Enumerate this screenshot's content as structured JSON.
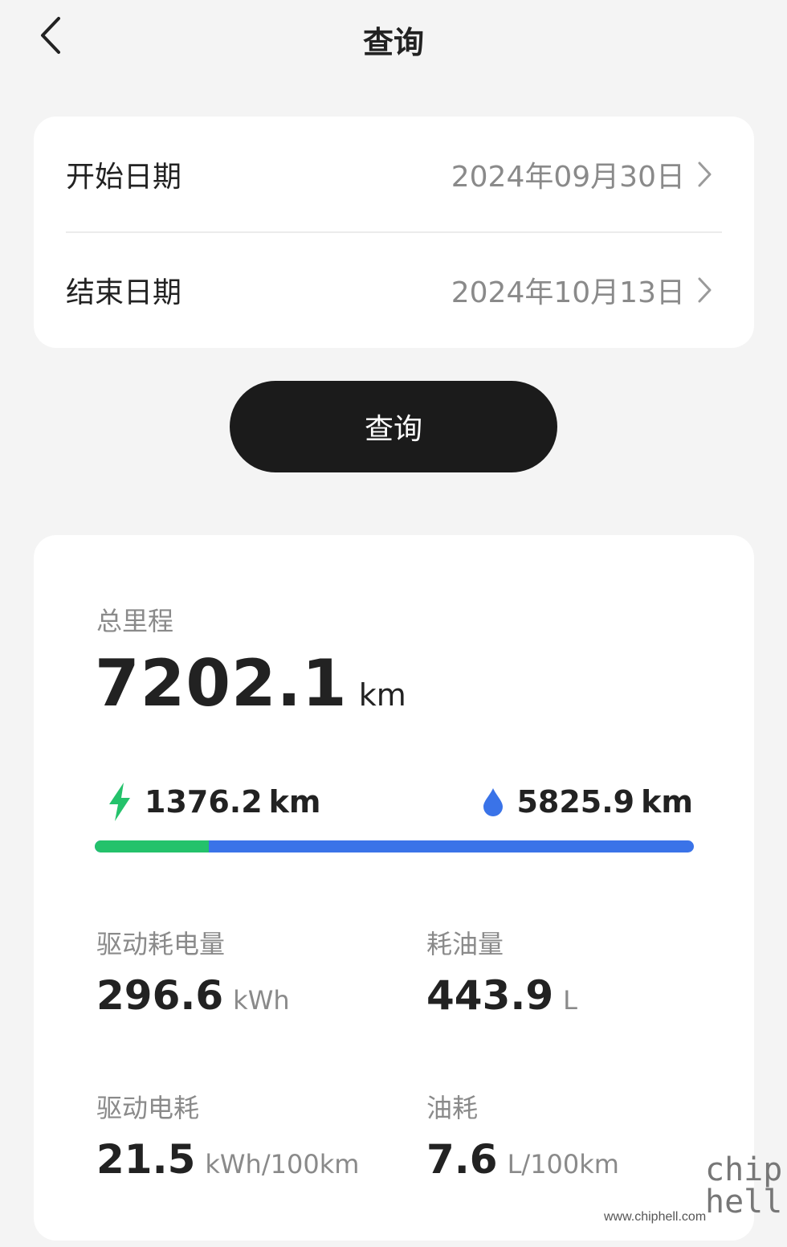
{
  "header": {
    "title": "查询"
  },
  "dates": {
    "start_label": "开始日期",
    "start_value": "2024年09月30日",
    "end_label": "结束日期",
    "end_value": "2024年10月13日"
  },
  "query_button": "查询",
  "stats": {
    "total_label": "总里程",
    "total_value": "7202.1",
    "total_unit": "km",
    "electric_value": "1376.2",
    "electric_unit": "km",
    "fuel_value": "5825.9",
    "fuel_unit": "km",
    "electric_share": 0.191,
    "colors": {
      "electric": "#24c26b",
      "fuel": "#3a73e8"
    },
    "metrics": [
      {
        "label": "驱动耗电量",
        "value": "296.6",
        "unit": "kWh"
      },
      {
        "label": "耗油量",
        "value": "443.9",
        "unit": "L"
      },
      {
        "label": "驱动电耗",
        "value": "21.5",
        "unit": "kWh/100km"
      },
      {
        "label": "油耗",
        "value": "7.6",
        "unit": "L/100km"
      }
    ]
  },
  "watermark": {
    "url": "www.chiphell.com",
    "logo": "chip hell"
  }
}
